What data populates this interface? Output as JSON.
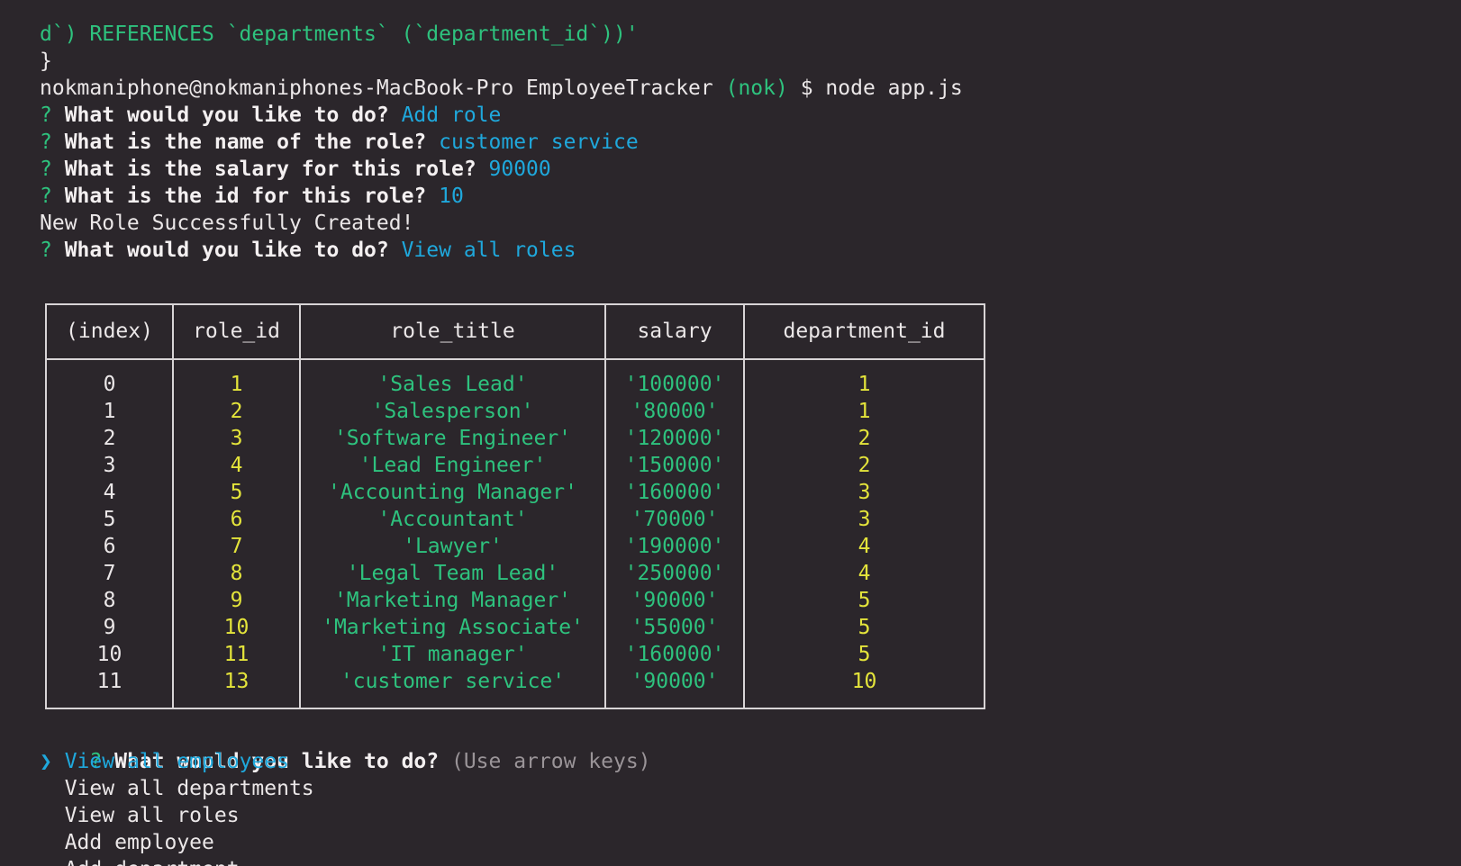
{
  "terminal": {
    "lines": [
      {
        "parts": [
          {
            "text": "d`) REFERENCES `departments` (`department_id`))'",
            "style": "green"
          }
        ]
      },
      {
        "parts": [
          {
            "text": "}",
            "style": "plain"
          }
        ]
      },
      {
        "parts": [
          {
            "text": "nokmaniphone@nokmaniphones-MacBook-Pro EmployeeTracker ",
            "style": "plain"
          },
          {
            "text": "(nok)",
            "style": "green"
          },
          {
            "text": " $ node app.js",
            "style": "plain"
          }
        ]
      },
      {
        "parts": [
          {
            "text": "? ",
            "style": "green"
          },
          {
            "text": "What would you like to do? ",
            "style": "bold"
          },
          {
            "text": "Add role",
            "style": "ans"
          }
        ]
      },
      {
        "parts": [
          {
            "text": "? ",
            "style": "green"
          },
          {
            "text": "What is the name of the role? ",
            "style": "bold"
          },
          {
            "text": "customer service",
            "style": "ans"
          }
        ]
      },
      {
        "parts": [
          {
            "text": "? ",
            "style": "green"
          },
          {
            "text": "What is the salary for this role? ",
            "style": "bold"
          },
          {
            "text": "90000",
            "style": "ans"
          }
        ]
      },
      {
        "parts": [
          {
            "text": "? ",
            "style": "green"
          },
          {
            "text": "What is the id for this role? ",
            "style": "bold"
          },
          {
            "text": "10",
            "style": "ans"
          }
        ]
      },
      {
        "parts": [
          {
            "text": "New Role Successfully Created!",
            "style": "plain"
          }
        ]
      },
      {
        "parts": [
          {
            "text": "? ",
            "style": "green"
          },
          {
            "text": "What would you like to do? ",
            "style": "bold"
          },
          {
            "text": "View all roles",
            "style": "ans"
          }
        ]
      }
    ],
    "table": {
      "headers": [
        "(index)",
        "role_id",
        "role_title",
        "salary",
        "department_id"
      ],
      "rows": [
        [
          "0",
          "1",
          "'Sales Lead'",
          "'100000'",
          "1"
        ],
        [
          "1",
          "2",
          "'Salesperson'",
          "'80000'",
          "1"
        ],
        [
          "2",
          "3",
          "'Software Engineer'",
          "'120000'",
          "2"
        ],
        [
          "3",
          "4",
          "'Lead Engineer'",
          "'150000'",
          "2"
        ],
        [
          "4",
          "5",
          "'Accounting Manager'",
          "'160000'",
          "3"
        ],
        [
          "5",
          "6",
          "'Accountant'",
          "'70000'",
          "3"
        ],
        [
          "6",
          "7",
          "'Lawyer'",
          "'190000'",
          "4"
        ],
        [
          "7",
          "8",
          "'Legal Team Lead'",
          "'250000'",
          "4"
        ],
        [
          "8",
          "9",
          "'Marketing Manager'",
          "'90000'",
          "5"
        ],
        [
          "9",
          "10",
          "'Marketing Associate'",
          "'55000'",
          "5"
        ],
        [
          "10",
          "11",
          "'IT manager'",
          "'160000'",
          "5"
        ],
        [
          "11",
          "13",
          "'customer service'",
          "'90000'",
          "10"
        ]
      ]
    },
    "prompt": {
      "marker": "? ",
      "question": "What would you like to do? ",
      "hint": "(Use arrow keys)"
    },
    "menu": {
      "pointer": "❯",
      "items": [
        "View all employees",
        "View all departments",
        "View all roles",
        "Add employee",
        "Add department"
      ],
      "selected_index": 0
    },
    "colors": {
      "background": "#2b262b",
      "green": "#2ec27e",
      "cyan": "#1fa8dc",
      "yellow": "#e4e43b",
      "text": "#ebe7e8"
    }
  }
}
